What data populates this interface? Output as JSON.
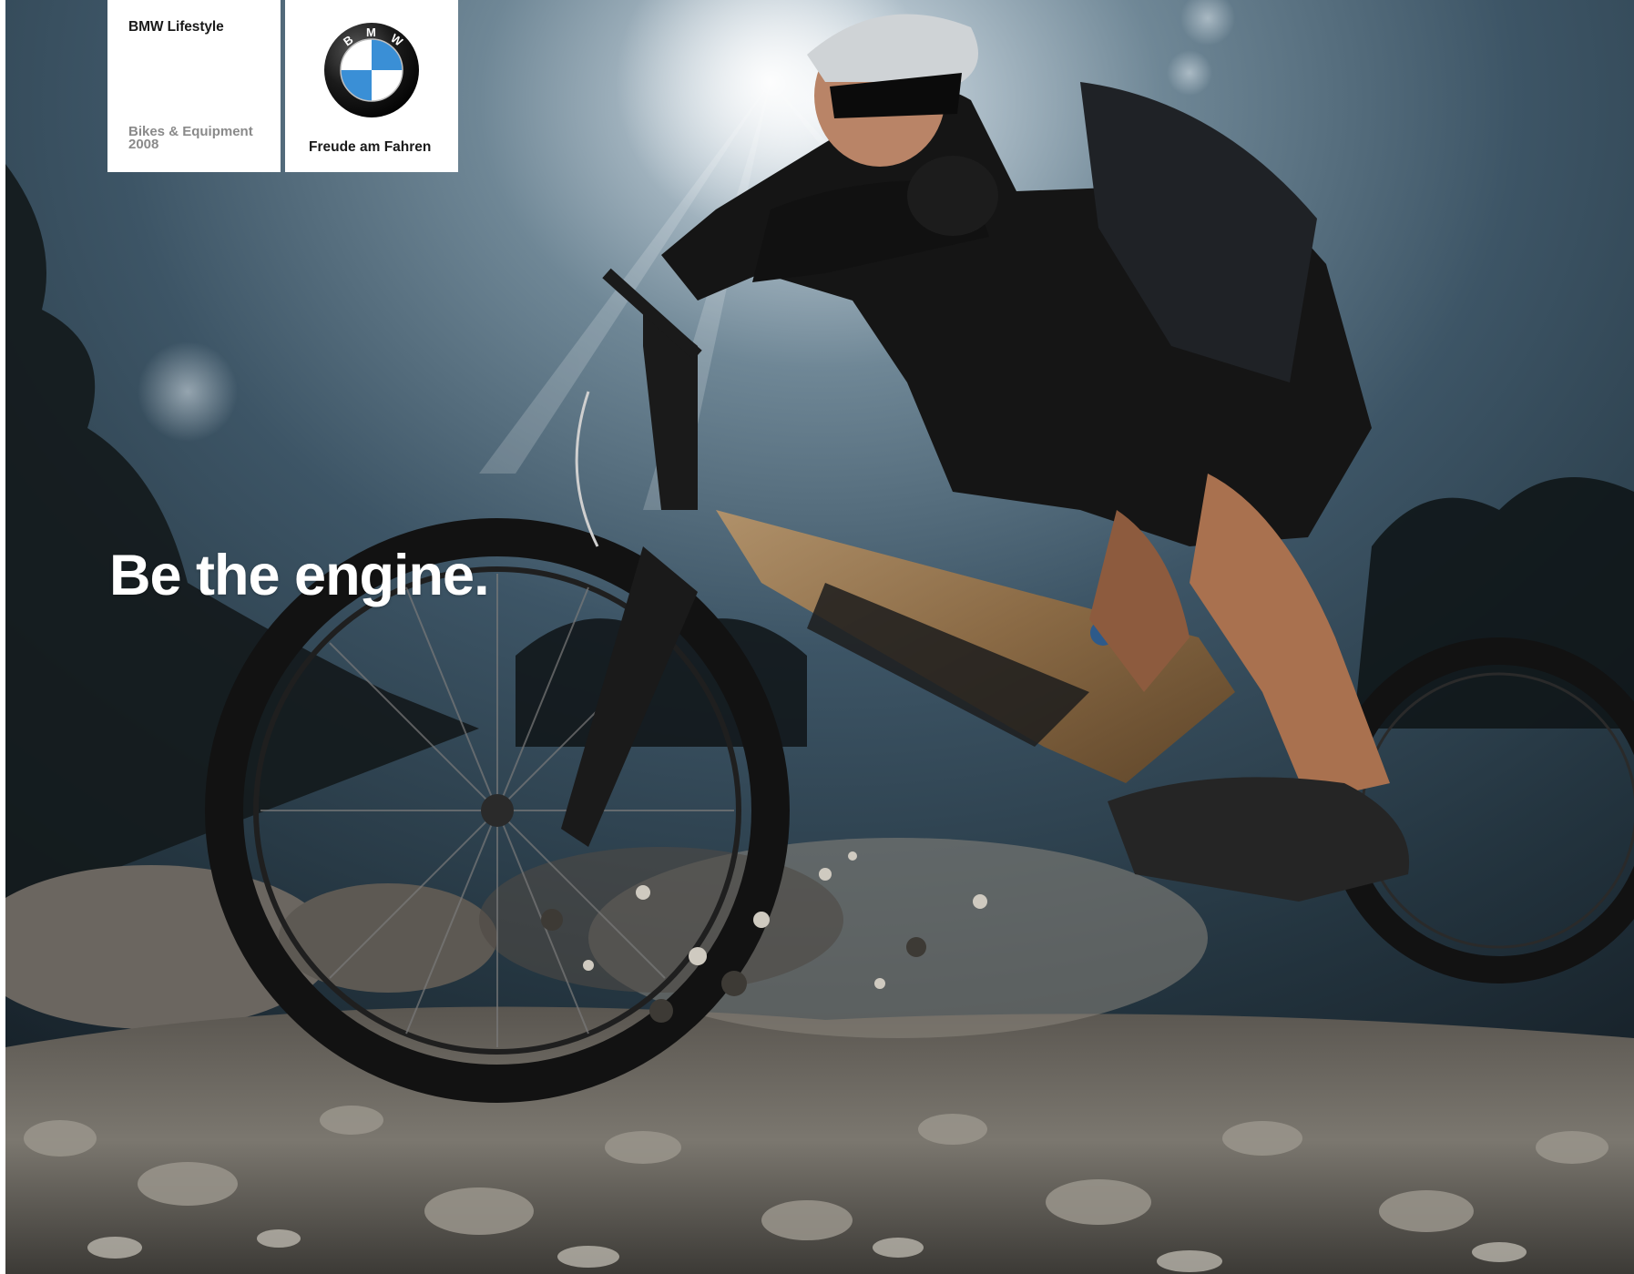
{
  "header": {
    "section_title": "BMW Lifestyle",
    "catalog_line1": "Bikes & Equipment",
    "catalog_line2": "2008"
  },
  "brand": {
    "logo_letters": "BMW",
    "tagline": "Freude am Fahren",
    "roundel_blue": "#3a8fd6",
    "roundel_ring": "#1b1b1b"
  },
  "hero": {
    "headline": "Be the engine.",
    "bike_color": "#8a6a45",
    "sky_color": "#3d5566"
  }
}
